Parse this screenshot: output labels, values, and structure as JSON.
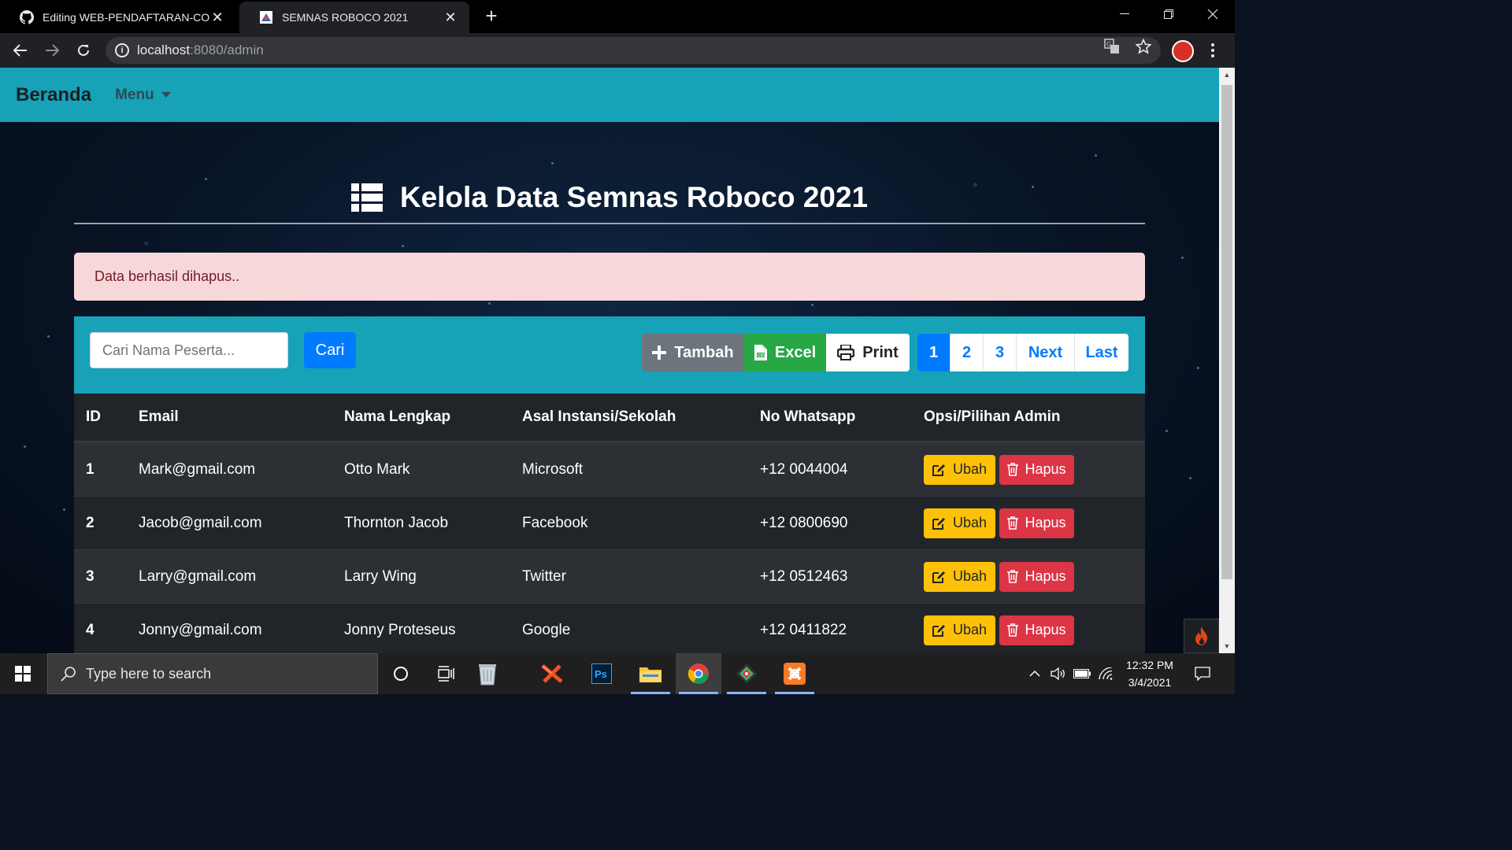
{
  "browser": {
    "tabs": [
      {
        "title": "Editing WEB-PENDAFTARAN-CO",
        "favicon": "github-icon",
        "close": "✕"
      },
      {
        "title": "SEMNAS ROBOCO 2021",
        "favicon": "site-logo-icon",
        "close": "✕"
      }
    ],
    "new_tab": "+",
    "url_host": "localhost",
    "url_rest": ":8080/admin"
  },
  "navbar": {
    "brand": "Beranda",
    "menu": "Menu"
  },
  "page": {
    "heading": "Kelola Data Semnas Roboco 2021",
    "alert": "Data berhasil dihapus..",
    "search_placeholder": "Cari Nama Peserta...",
    "search_button": "Cari",
    "buttons": {
      "tambah": "Tambah",
      "excel": "Excel",
      "print": "Print"
    },
    "pagination": [
      "1",
      "2",
      "3",
      "Next",
      "Last"
    ],
    "active_page": "1"
  },
  "table": {
    "headers": [
      "ID",
      "Email",
      "Nama Lengkap",
      "Asal Instansi/Sekolah",
      "No Whatsapp",
      "Opsi/Pilihan Admin"
    ],
    "rows": [
      {
        "id": "1",
        "email": "Mark@gmail.com",
        "nama": "Otto Mark",
        "instansi": "Microsoft",
        "whatsapp": "+12 0044004"
      },
      {
        "id": "2",
        "email": "Jacob@gmail.com",
        "nama": "Thornton Jacob",
        "instansi": "Facebook",
        "whatsapp": "+12 0800690"
      },
      {
        "id": "3",
        "email": "Larry@gmail.com",
        "nama": "Larry Wing",
        "instansi": "Twitter",
        "whatsapp": "+12 0512463"
      },
      {
        "id": "4",
        "email": "Jonny@gmail.com",
        "nama": "Jonny Proteseus",
        "instansi": "Google",
        "whatsapp": "+12 0411822"
      }
    ],
    "action_edit": "Ubah",
    "action_delete": "Hapus"
  },
  "taskbar": {
    "search_placeholder": "Type here to search",
    "time": "12:32 PM",
    "date": "3/4/2021"
  },
  "colors": {
    "navbar": "#17a2b8",
    "primary": "#007bff",
    "success": "#28a745",
    "secondary": "#6c757d",
    "warning": "#ffc107",
    "danger": "#dc3545",
    "alert_bg": "#f8d7da",
    "table_dark": "#212529"
  }
}
